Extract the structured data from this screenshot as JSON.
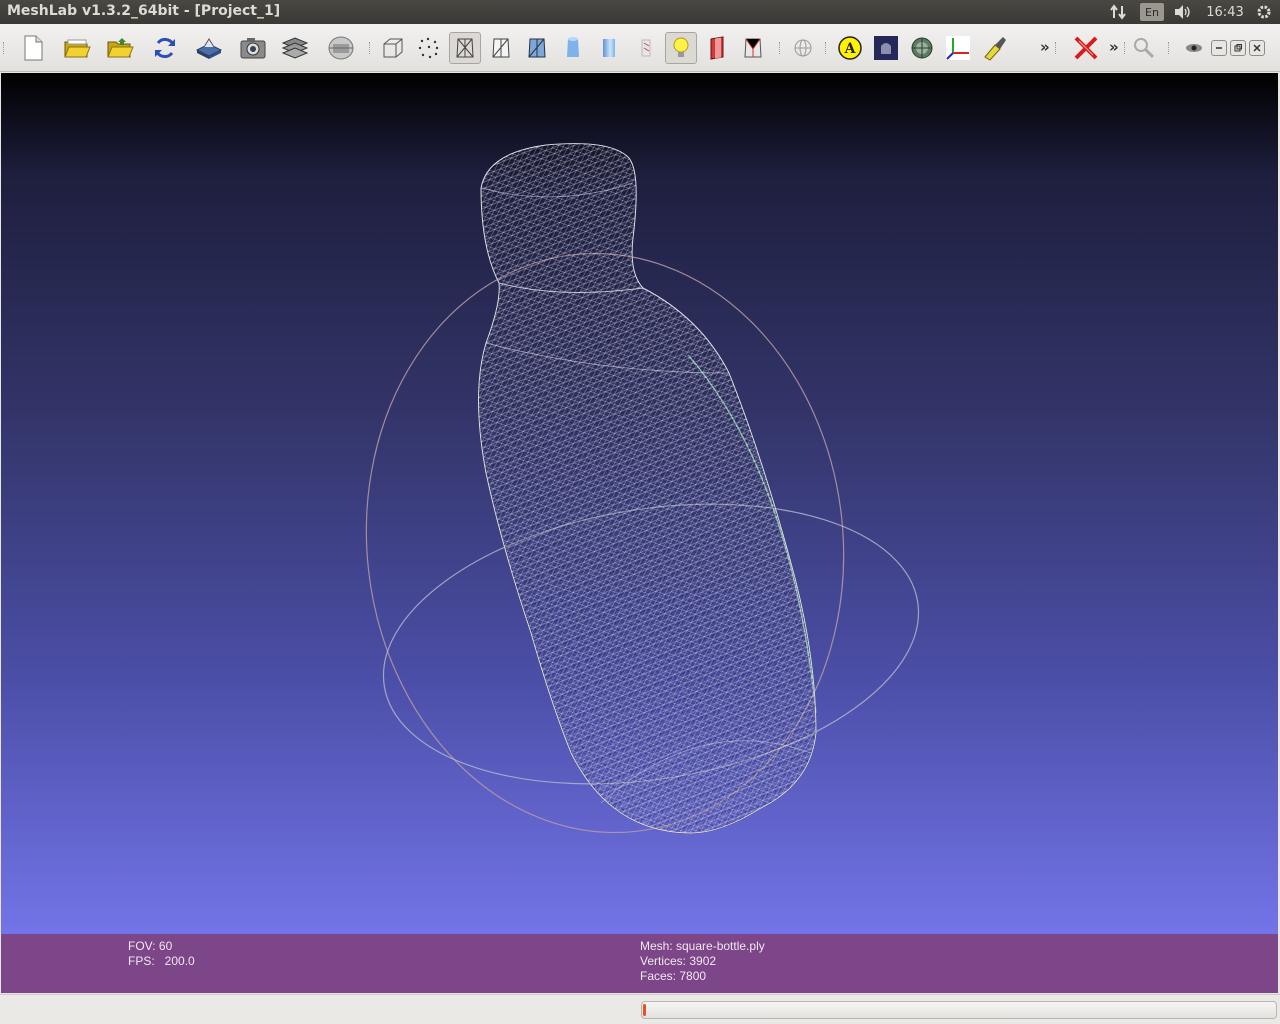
{
  "window": {
    "title": "MeshLab v1.3.2_64bit - [Project_1]"
  },
  "panel": {
    "keyboard_layout": "En",
    "clock": "16:43"
  },
  "toolbar": {
    "overflow_glyph": "»",
    "icons": [
      "new-document-icon",
      "open-project-icon",
      "import-mesh-icon",
      "reload-icon",
      "export-mesh-icon",
      "snapshot-icon",
      "layers-icon",
      "raster-icon",
      "bounding-box-icon",
      "points-icon",
      "wireframe-icon",
      "hidden-lines-icon",
      "flat-lines-icon",
      "flat-icon",
      "smooth-icon",
      "texture-icon",
      "light-icon",
      "double-side-lighting-icon",
      "back-face-icon",
      "sphere-icon",
      "annotation-icon",
      "decorate-icon",
      "rotate-icon",
      "axis-icon",
      "paint-icon",
      "delete-icon",
      "search-icon",
      "eye-icon"
    ]
  },
  "info": {
    "fov_label": "FOV: 60",
    "fps_label": "FPS:   200.0",
    "mesh_label": "Mesh: square-bottle.ply",
    "vertices_label": "Vertices: 3902",
    "faces_label": "Faces: 7800"
  },
  "status": {
    "progress_fraction": 0.005
  },
  "colors": {
    "info_bar": "#7c4688",
    "progress_fill": "#e8502a",
    "wire": "#d8d8e0"
  }
}
